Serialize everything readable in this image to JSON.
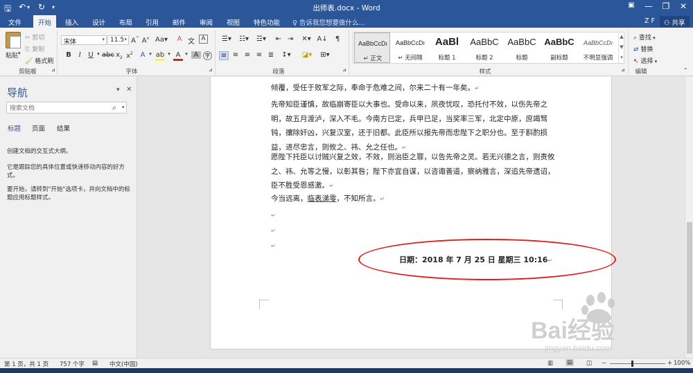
{
  "titlebar": {
    "doc_title": "出师表.docx - Word",
    "save_icon": "save-icon",
    "undo_icon": "undo-icon",
    "redo_icon": "redo-icon"
  },
  "tabs": {
    "file": "文件",
    "home": "开始",
    "insert": "插入",
    "design": "设计",
    "layout": "布局",
    "references": "引用",
    "mailings": "邮件",
    "review": "审阅",
    "view": "视图",
    "features": "特色功能",
    "tell_me": "告诉我您想要做什么...",
    "user": "Z F",
    "share": "共享"
  },
  "ribbon": {
    "clipboard": {
      "paste": "粘贴",
      "cut": "剪切",
      "copy": "复制",
      "format_painter": "格式刷",
      "label": "剪贴板"
    },
    "font": {
      "family": "宋体",
      "size": "11.5",
      "label": "字体"
    },
    "paragraph": {
      "label": "段落"
    },
    "styles": {
      "label": "样式",
      "items": [
        {
          "sample": "AaBbCcDı",
          "name": "↵ 正文"
        },
        {
          "sample": "AaBbCcDı",
          "name": "↵ 无间隔"
        },
        {
          "sample": "AaBl",
          "name": "标题 1"
        },
        {
          "sample": "AaBbC",
          "name": "标题 2"
        },
        {
          "sample": "AaBbC",
          "name": "标题"
        },
        {
          "sample": "AaBbC",
          "name": "副标题"
        },
        {
          "sample": "AaBbCcDı",
          "name": "不明显强调"
        }
      ]
    },
    "editing": {
      "find": "查找",
      "replace": "替换",
      "select": "选择",
      "label": "编辑"
    }
  },
  "nav": {
    "title": "导航",
    "search_placeholder": "搜索文档",
    "tabs": [
      "标题",
      "页面",
      "结果"
    ],
    "hint1": "创建文档的交互式大纲。",
    "hint2": "它是跟踪您的具体位置或快速移动内容的好方式。",
    "hint3": "要开始，请转到\"开始\"选项卡，并向文档中的标题应用标题样式。"
  },
  "document": {
    "p0_line1": "倾覆，受任于败军之际，奉命于危难之间，尔来二十有一年矣。",
    "p1": "先帝知臣谨慎，故临崩寄臣以大事也。受命以来，夙夜忧叹，恐托付不效，以伤先帝之明，故五月渡泸，深入不毛。今南方已定，兵甲已足，当奖率三军，北定中原，庶竭驽钝，攘除奸凶，兴复汉室，还于旧都。此臣所以报先帝而忠陛下之职分也。至于斟酌损益，进尽忠言，则攸之、祎、允之任也。",
    "p2": "愿陛下托臣以讨贼兴复之效，不效，则治臣之罪，以告先帝之灵。若无兴德之言，则责攸之、祎、允等之慢，以彰其咎；陛下亦宜自谋，以咨诹善道，察纳雅言，深追先帝遗诏，臣不胜受恩感激。",
    "p3_before": "今当远离，",
    "p3_link": "临表涕零",
    "p3_after": "，不知所言。",
    "date_line": "日期：2018 年 7 月 25 日  星期三  10:16"
  },
  "status": {
    "page": "第 1 页，共 1 页",
    "words": "757 个字",
    "lang": "中文(中国)",
    "zoom": "100%"
  },
  "watermark": {
    "brand": "Bai经验",
    "url": "jingyan.baidu.com"
  },
  "colors": {
    "ribbon_blue": "#2b579a",
    "highlight_ellipse": "#e02020"
  }
}
